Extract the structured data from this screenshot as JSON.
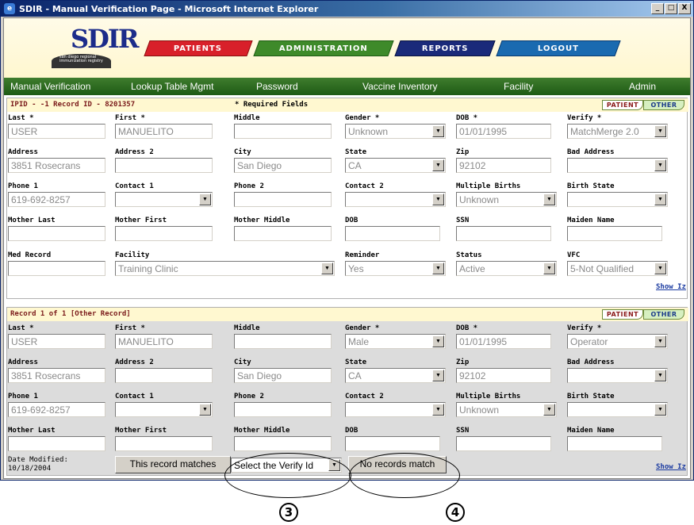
{
  "window": {
    "title": "SDIR - Manual Verification Page - Microsoft Internet Explorer",
    "btn_min": "_",
    "btn_max": "□",
    "btn_close": "X"
  },
  "logo": {
    "text": "SDIR",
    "sub": "san diego regional immunization registry"
  },
  "nav": {
    "patients": "PATIENTS",
    "administration": "ADMINISTRATION",
    "reports": "REPORTS",
    "logout": "LOGOUT"
  },
  "menu": {
    "m1": "Manual Verification",
    "m2": "Lookup Table Mgmt",
    "m3": "Password",
    "m4": "Vaccine Inventory",
    "m5": "Facility",
    "m6": "Admin"
  },
  "colors": {
    "patients": "#d8202a",
    "administration": "#3e8a2a",
    "reports": "#1a2a7a",
    "logout": "#1a6ab0"
  },
  "top": {
    "header": "IPID - -1  Record ID - 8201357",
    "required": "* Required Fields",
    "patient_btn": "PATIENT",
    "other_btn": "OTHER",
    "last_lbl": "Last *",
    "last": "USER",
    "first_lbl": "First *",
    "first": "MANUELITO",
    "middle_lbl": "Middle",
    "middle": "",
    "gender_lbl": "Gender *",
    "gender": "Unknown",
    "dob_lbl": "DOB *",
    "dob": "01/01/1995",
    "verify_lbl": "Verify *",
    "verify": "MatchMerge 2.0",
    "addr_lbl": "Address",
    "addr": "3851 Rosecrans",
    "addr2_lbl": "Address 2",
    "addr2": "",
    "city_lbl": "City",
    "city": "San Diego",
    "state_lbl": "State",
    "state": "CA",
    "zip_lbl": "Zip",
    "zip": "92102",
    "bad_lbl": "Bad Address",
    "bad": "",
    "ph1_lbl": "Phone 1",
    "ph1": "619-692-8257",
    "c1_lbl": "Contact 1",
    "c1": "",
    "ph2_lbl": "Phone 2",
    "ph2": "",
    "c2_lbl": "Contact 2",
    "c2": "",
    "mb_lbl": "Multiple Births",
    "mb": "Unknown",
    "bs_lbl": "Birth State",
    "bs": "",
    "ml_lbl": "Mother Last",
    "ml": "",
    "mf_lbl": "Mother First",
    "mf": "",
    "mm_lbl": "Mother Middle",
    "mm": "",
    "mdob_lbl": "DOB",
    "mdob": "",
    "ssn_lbl": "SSN",
    "ssn": "",
    "maiden_lbl": "Maiden Name",
    "maiden": "",
    "med_lbl": "Med Record",
    "med": "",
    "fac_lbl": "Facility",
    "fac": "Training Clinic",
    "rem_lbl": "Reminder",
    "rem": "Yes",
    "status_lbl": "Status",
    "status": "Active",
    "vfc_lbl": "VFC",
    "vfc": "5-Not Qualified",
    "showiz": "Show Iz"
  },
  "bottom": {
    "header": "Record 1 of 1 [Other Record]",
    "patient_btn": "PATIENT",
    "other_btn": "OTHER",
    "last_lbl": "Last *",
    "last": "USER",
    "first_lbl": "First *",
    "first": "MANUELITO",
    "middle_lbl": "Middle",
    "middle": "",
    "gender_lbl": "Gender *",
    "gender": "Male",
    "dob_lbl": "DOB *",
    "dob": "01/01/1995",
    "verify_lbl": "Verify *",
    "verify": "Operator",
    "addr_lbl": "Address",
    "addr": "3851 Rosecrans",
    "addr2_lbl": "Address 2",
    "addr2": "",
    "city_lbl": "City",
    "city": "San Diego",
    "state_lbl": "State",
    "state": "CA",
    "zip_lbl": "Zip",
    "zip": "92102",
    "bad_lbl": "Bad Address",
    "bad": "",
    "ph1_lbl": "Phone 1",
    "ph1": "619-692-8257",
    "c1_lbl": "Contact 1",
    "c1": "",
    "ph2_lbl": "Phone 2",
    "ph2": "",
    "c2_lbl": "Contact 2",
    "c2": "",
    "mb_lbl": "Multiple Births",
    "mb": "Unknown",
    "bs_lbl": "Birth State",
    "bs": "",
    "ml_lbl": "Mother Last",
    "ml": "",
    "mf_lbl": "Mother First",
    "mf": "",
    "mm_lbl": "Mother Middle",
    "mm": "",
    "mdob_lbl": "DOB",
    "mdob": "",
    "ssn_lbl": "SSN",
    "ssn": "",
    "maiden_lbl": "Maiden Name",
    "maiden": "",
    "date_lbl": "Date Modified:",
    "date": "10/18/2004",
    "match_btn": "This record matches",
    "verify_select": "Select the Verify Id",
    "nomatch_btn": "No records match",
    "showiz": "Show Iz"
  },
  "annotations": {
    "n3": "3",
    "n4": "4"
  }
}
